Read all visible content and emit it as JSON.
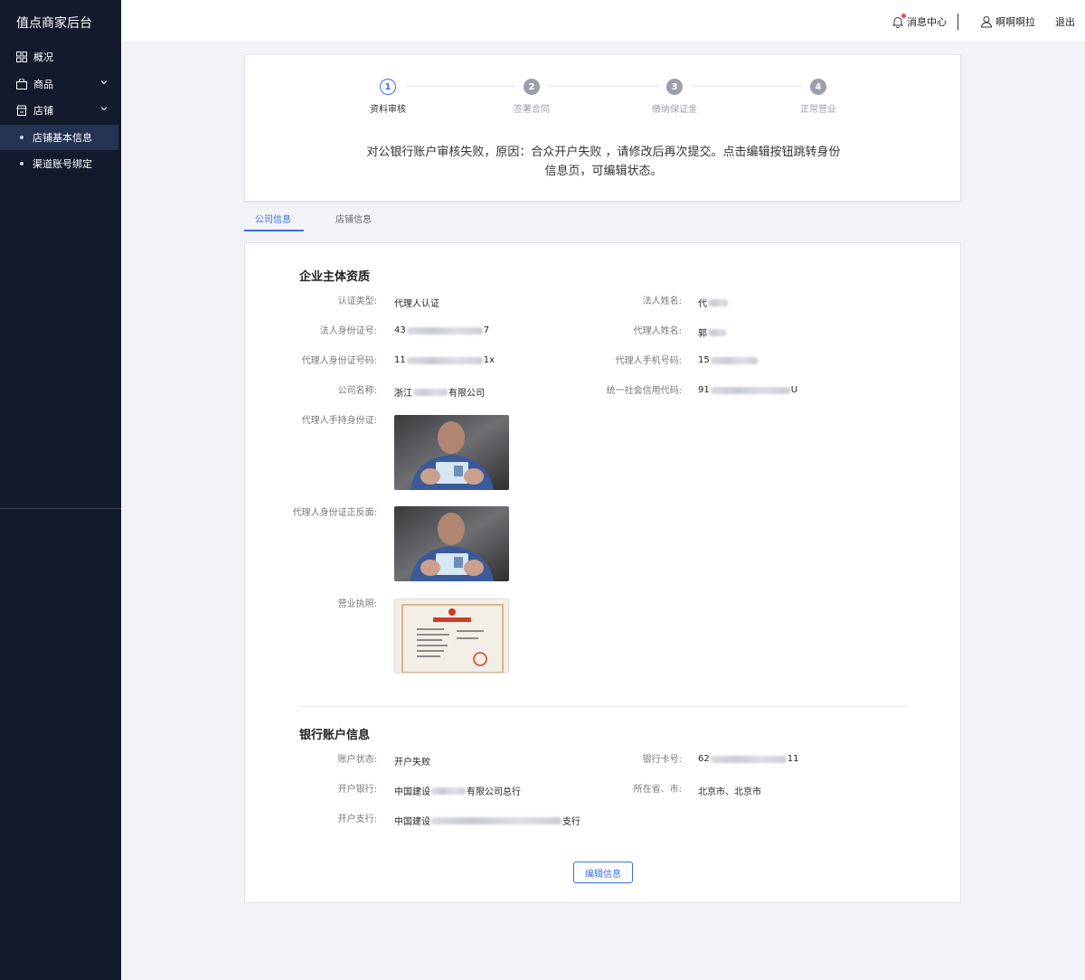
{
  "sidebar": {
    "brand": "值点商家后台",
    "menu": [
      {
        "label": "概况",
        "icon": "grid-icon"
      },
      {
        "label": "商品",
        "icon": "bag-icon"
      },
      {
        "label": "店铺",
        "icon": "store-icon"
      }
    ],
    "submenu": [
      {
        "label": "店铺基本信息",
        "active": true
      },
      {
        "label": "渠道账号绑定",
        "active": false
      }
    ]
  },
  "header": {
    "messages": "消息中心",
    "user": "啊啊啊拉",
    "logout": "退出"
  },
  "steps": [
    {
      "num": "1",
      "label": "资料审核",
      "active": true
    },
    {
      "num": "2",
      "label": "签署合同",
      "active": false
    },
    {
      "num": "3",
      "label": "缴纳保证金",
      "active": false
    },
    {
      "num": "4",
      "label": "正常营业",
      "active": false
    }
  ],
  "failure_message": {
    "line1": "对公银行账户审核失败，原因：合众开户失败 ，请修改后再次提交。点击编辑按钮跳转身份",
    "line2": "信息页，可编辑状态。"
  },
  "tabs": [
    {
      "label": "公司信息",
      "active": true
    },
    {
      "label": "店铺信息",
      "active": false
    }
  ],
  "enterprise": {
    "title": "企业主体资质",
    "cert_type": {
      "label": "认证类型:",
      "value": "代理人认证"
    },
    "legal_name": {
      "label": "法人姓名:",
      "prefix": "代",
      "suffix": ""
    },
    "legal_id": {
      "label": "法人身份证号:",
      "prefix": "43",
      "suffix": "7"
    },
    "agent_name": {
      "label": "代理人姓名:",
      "prefix": "郭",
      "suffix": ""
    },
    "agent_id": {
      "label": "代理人身份证号码:",
      "prefix": "11",
      "suffix": "1x"
    },
    "agent_phone": {
      "label": "代理人手机号码:",
      "prefix": "15",
      "suffix": ""
    },
    "company_name": {
      "label": "公司名称:",
      "prefix": "浙江",
      "suffix": "有限公司"
    },
    "credit_code": {
      "label": "统一社会信用代码:",
      "prefix": "91",
      "suffix": "U"
    },
    "agent_hold_id": {
      "label": "代理人手持身份证:"
    },
    "agent_id_both": {
      "label": "代理人身份证正反面:"
    },
    "license": {
      "label": "营业执照:"
    }
  },
  "bank": {
    "title": "银行账户信息",
    "status": {
      "label": "账户状态:",
      "value": "开户失败"
    },
    "card_no": {
      "label": "银行卡号:",
      "prefix": "62",
      "suffix": "11"
    },
    "bank_name": {
      "label": "开户银行:",
      "prefix": "中国建设",
      "suffix": "有限公司总行"
    },
    "region": {
      "label": "所在省、市:",
      "value": "北京市、北京市"
    },
    "branch": {
      "label": "开户支行:",
      "prefix": "中国建设",
      "suffix": "支行"
    }
  },
  "edit_button": "编辑信息",
  "colors": {
    "accent": "#3d6ee8",
    "sidebar_bg": "#131a2b",
    "sidebar_active": "#243352"
  }
}
